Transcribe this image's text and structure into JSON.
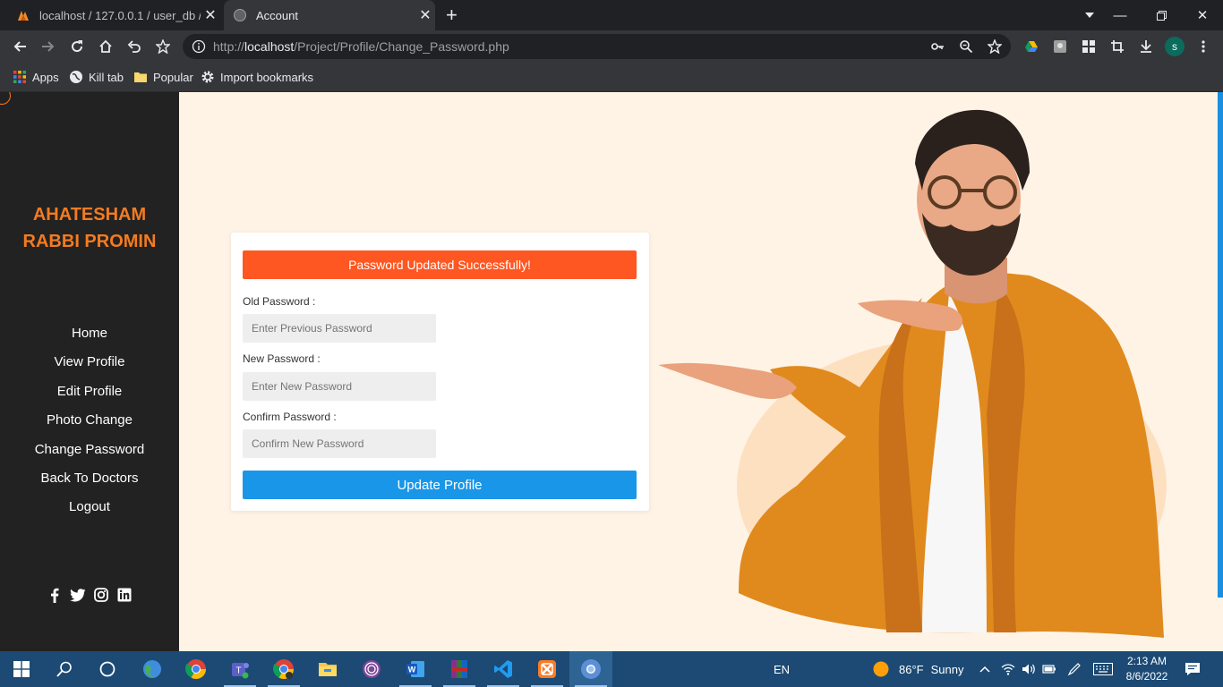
{
  "browser": {
    "tabs": [
      {
        "title": "localhost / 127.0.0.1 / user_db / u",
        "active": false
      },
      {
        "title": "Account",
        "active": true
      }
    ],
    "url_prefix": "http://",
    "url_host": "localhost",
    "url_path": "/Project/Profile/Change_Password.php",
    "bookmarks": [
      "Apps",
      "Kill tab",
      "Popular",
      "Import bookmarks"
    ],
    "profile_initial": "s"
  },
  "sidebar": {
    "name_line1": "AHATESHAM",
    "name_line2": "RABBI PROMIN",
    "nav": [
      "Home",
      "View Profile",
      "Edit Profile",
      "Photo Change",
      "Change Password",
      "Back To Doctors",
      "Logout"
    ]
  },
  "form": {
    "alert": "Password Updated Successfully!",
    "old_label": "Old Password :",
    "old_placeholder": "Enter Previous Password",
    "new_label": "New Password :",
    "new_placeholder": "Enter New Password",
    "confirm_label": "Confirm Password :",
    "confirm_placeholder": "Confirm New Password",
    "submit": "Update Profile"
  },
  "taskbar": {
    "language": "EN",
    "weather_temp": "86°F",
    "weather_text": "Sunny",
    "time": "2:13 AM",
    "date": "8/6/2022"
  },
  "colors": {
    "accent": "#f47b20",
    "alert": "#ff5722",
    "button": "#1a96e8",
    "sidebar": "#222222",
    "page_bg": "#fff3e6"
  }
}
